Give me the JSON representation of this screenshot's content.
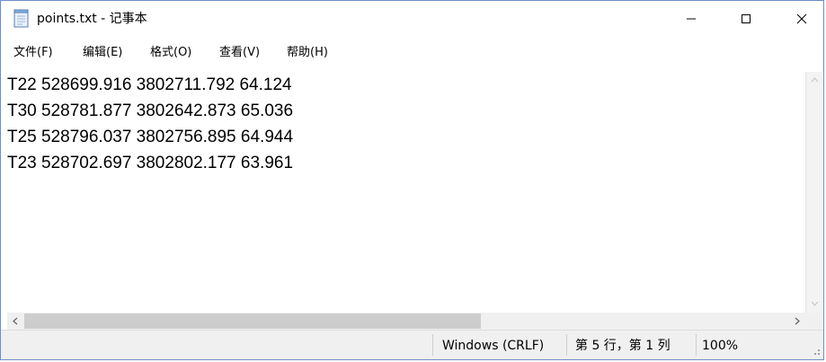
{
  "window": {
    "title": "points.txt - 记事本",
    "minimize_glyph": "—",
    "maximize_glyph": "☐",
    "close_glyph": "✕"
  },
  "menu": {
    "items": [
      {
        "label": "文件(F)"
      },
      {
        "label": "编辑(E)"
      },
      {
        "label": "格式(O)"
      },
      {
        "label": "查看(V)"
      },
      {
        "label": "帮助(H)"
      }
    ]
  },
  "editor": {
    "lines": [
      "T22 528699.916 3802711.792 64.124",
      "T30 528781.877 3802642.873 65.036",
      "T25 528796.037 3802756.895 64.944",
      "T23 528702.697 3802802.177 63.961"
    ]
  },
  "statusbar": {
    "line_ending": "Windows (CRLF)",
    "position": "第 5 行，第 1 列",
    "zoom": "100%"
  },
  "icons": {
    "app": "notepad-icon",
    "scroll_left": "chevron-left-icon",
    "scroll_right": "chevron-right-icon",
    "scroll_up": "chevron-up-icon",
    "scroll_down": "chevron-down-icon"
  },
  "colors": {
    "window_border": "#6b8fc7",
    "scroll_thumb": "#cdcdcd",
    "statusbar_bg": "#f0f0f0"
  }
}
